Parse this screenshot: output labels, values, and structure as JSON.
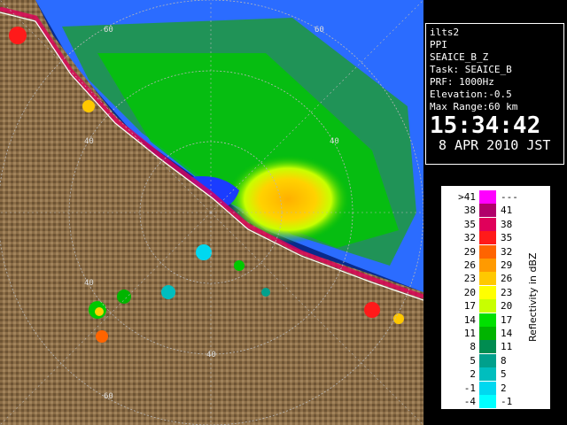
{
  "info": {
    "site": "ilts2",
    "scan_type": "PPI",
    "product": "SEAICE_B_Z",
    "task": "Task: SEAICE_B",
    "prf": "PRF: 1000Hz",
    "elevation": "Elevation:-0.5",
    "max_range": "Max Range:60 km",
    "time": "15:34:42",
    "date": "8 APR 2010 JST"
  },
  "range_labels": [
    "60",
    "60",
    "40",
    "40",
    "40",
    "40",
    "60"
  ],
  "legend": {
    "title": "Reflectivity in dBZ",
    "rows": [
      {
        "lo": ">41",
        "hi": "---",
        "color": "#ff00ff"
      },
      {
        "lo": "38",
        "hi": "41",
        "color": "#b0006a"
      },
      {
        "lo": "35",
        "hi": "38",
        "color": "#e0005a"
      },
      {
        "lo": "32",
        "hi": "35",
        "color": "#ff1a1a"
      },
      {
        "lo": "29",
        "hi": "32",
        "color": "#ff6400"
      },
      {
        "lo": "26",
        "hi": "29",
        "color": "#ff9a00"
      },
      {
        "lo": "23",
        "hi": "26",
        "color": "#ffc800"
      },
      {
        "lo": "20",
        "hi": "23",
        "color": "#ffff00"
      },
      {
        "lo": "17",
        "hi": "20",
        "color": "#c8ff00"
      },
      {
        "lo": "14",
        "hi": "17",
        "color": "#00e000"
      },
      {
        "lo": "11",
        "hi": "14",
        "color": "#00b400"
      },
      {
        "lo": "8",
        "hi": "11",
        "color": "#008c50"
      },
      {
        "lo": "5",
        "hi": "8",
        "color": "#00a08c"
      },
      {
        "lo": "2",
        "hi": "5",
        "color": "#00bebe"
      },
      {
        "lo": "-1",
        "hi": "2",
        "color": "#00d8f0"
      },
      {
        "lo": "-4",
        "hi": "-1",
        "color": "#00ffff"
      }
    ]
  },
  "colors": {
    "sea": "#0a2a8a",
    "land": "#8a6e48",
    "echo_light": "#2b6cff",
    "grid": "#b8b8b8"
  }
}
